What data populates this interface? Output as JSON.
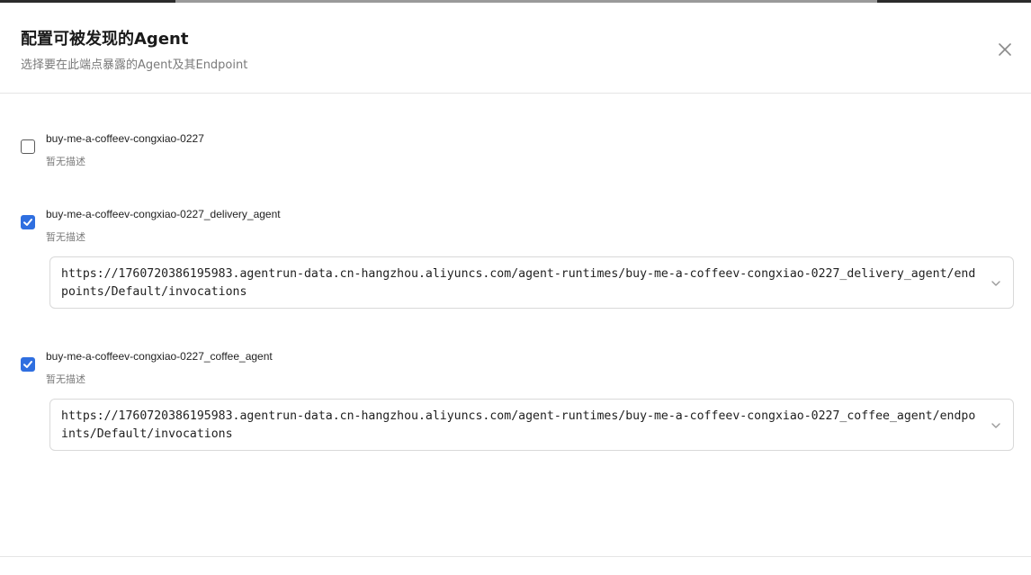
{
  "dialog": {
    "title": "配置可被发现的Agent",
    "subtitle": "选择要在此端点暴露的Agent及其Endpoint"
  },
  "agents": [
    {
      "name": "buy-me-a-coffeev-congxiao-0227",
      "description": "暂无描述",
      "checked": false
    },
    {
      "name": "buy-me-a-coffeev-congxiao-0227_delivery_agent",
      "description": "暂无描述",
      "checked": true,
      "endpoint": "https://1760720386195983.agentrun-data.cn-hangzhou.aliyuncs.com/agent-runtimes/buy-me-a-coffeev-congxiao-0227_delivery_agent/endpoints/Default/invocations"
    },
    {
      "name": "buy-me-a-coffeev-congxiao-0227_coffee_agent",
      "description": "暂无描述",
      "checked": true,
      "endpoint": "https://1760720386195983.agentrun-data.cn-hangzhou.aliyuncs.com/agent-runtimes/buy-me-a-coffeev-congxiao-0227_coffee_agent/endpoints/Default/invocations"
    }
  ],
  "icons": {
    "close": "close-icon",
    "check": "check-icon",
    "chevron": "chevron-down-icon"
  },
  "colors": {
    "accent": "#2f6fe0",
    "border": "#d9d9d9",
    "muted_text": "#7a7a7a"
  }
}
